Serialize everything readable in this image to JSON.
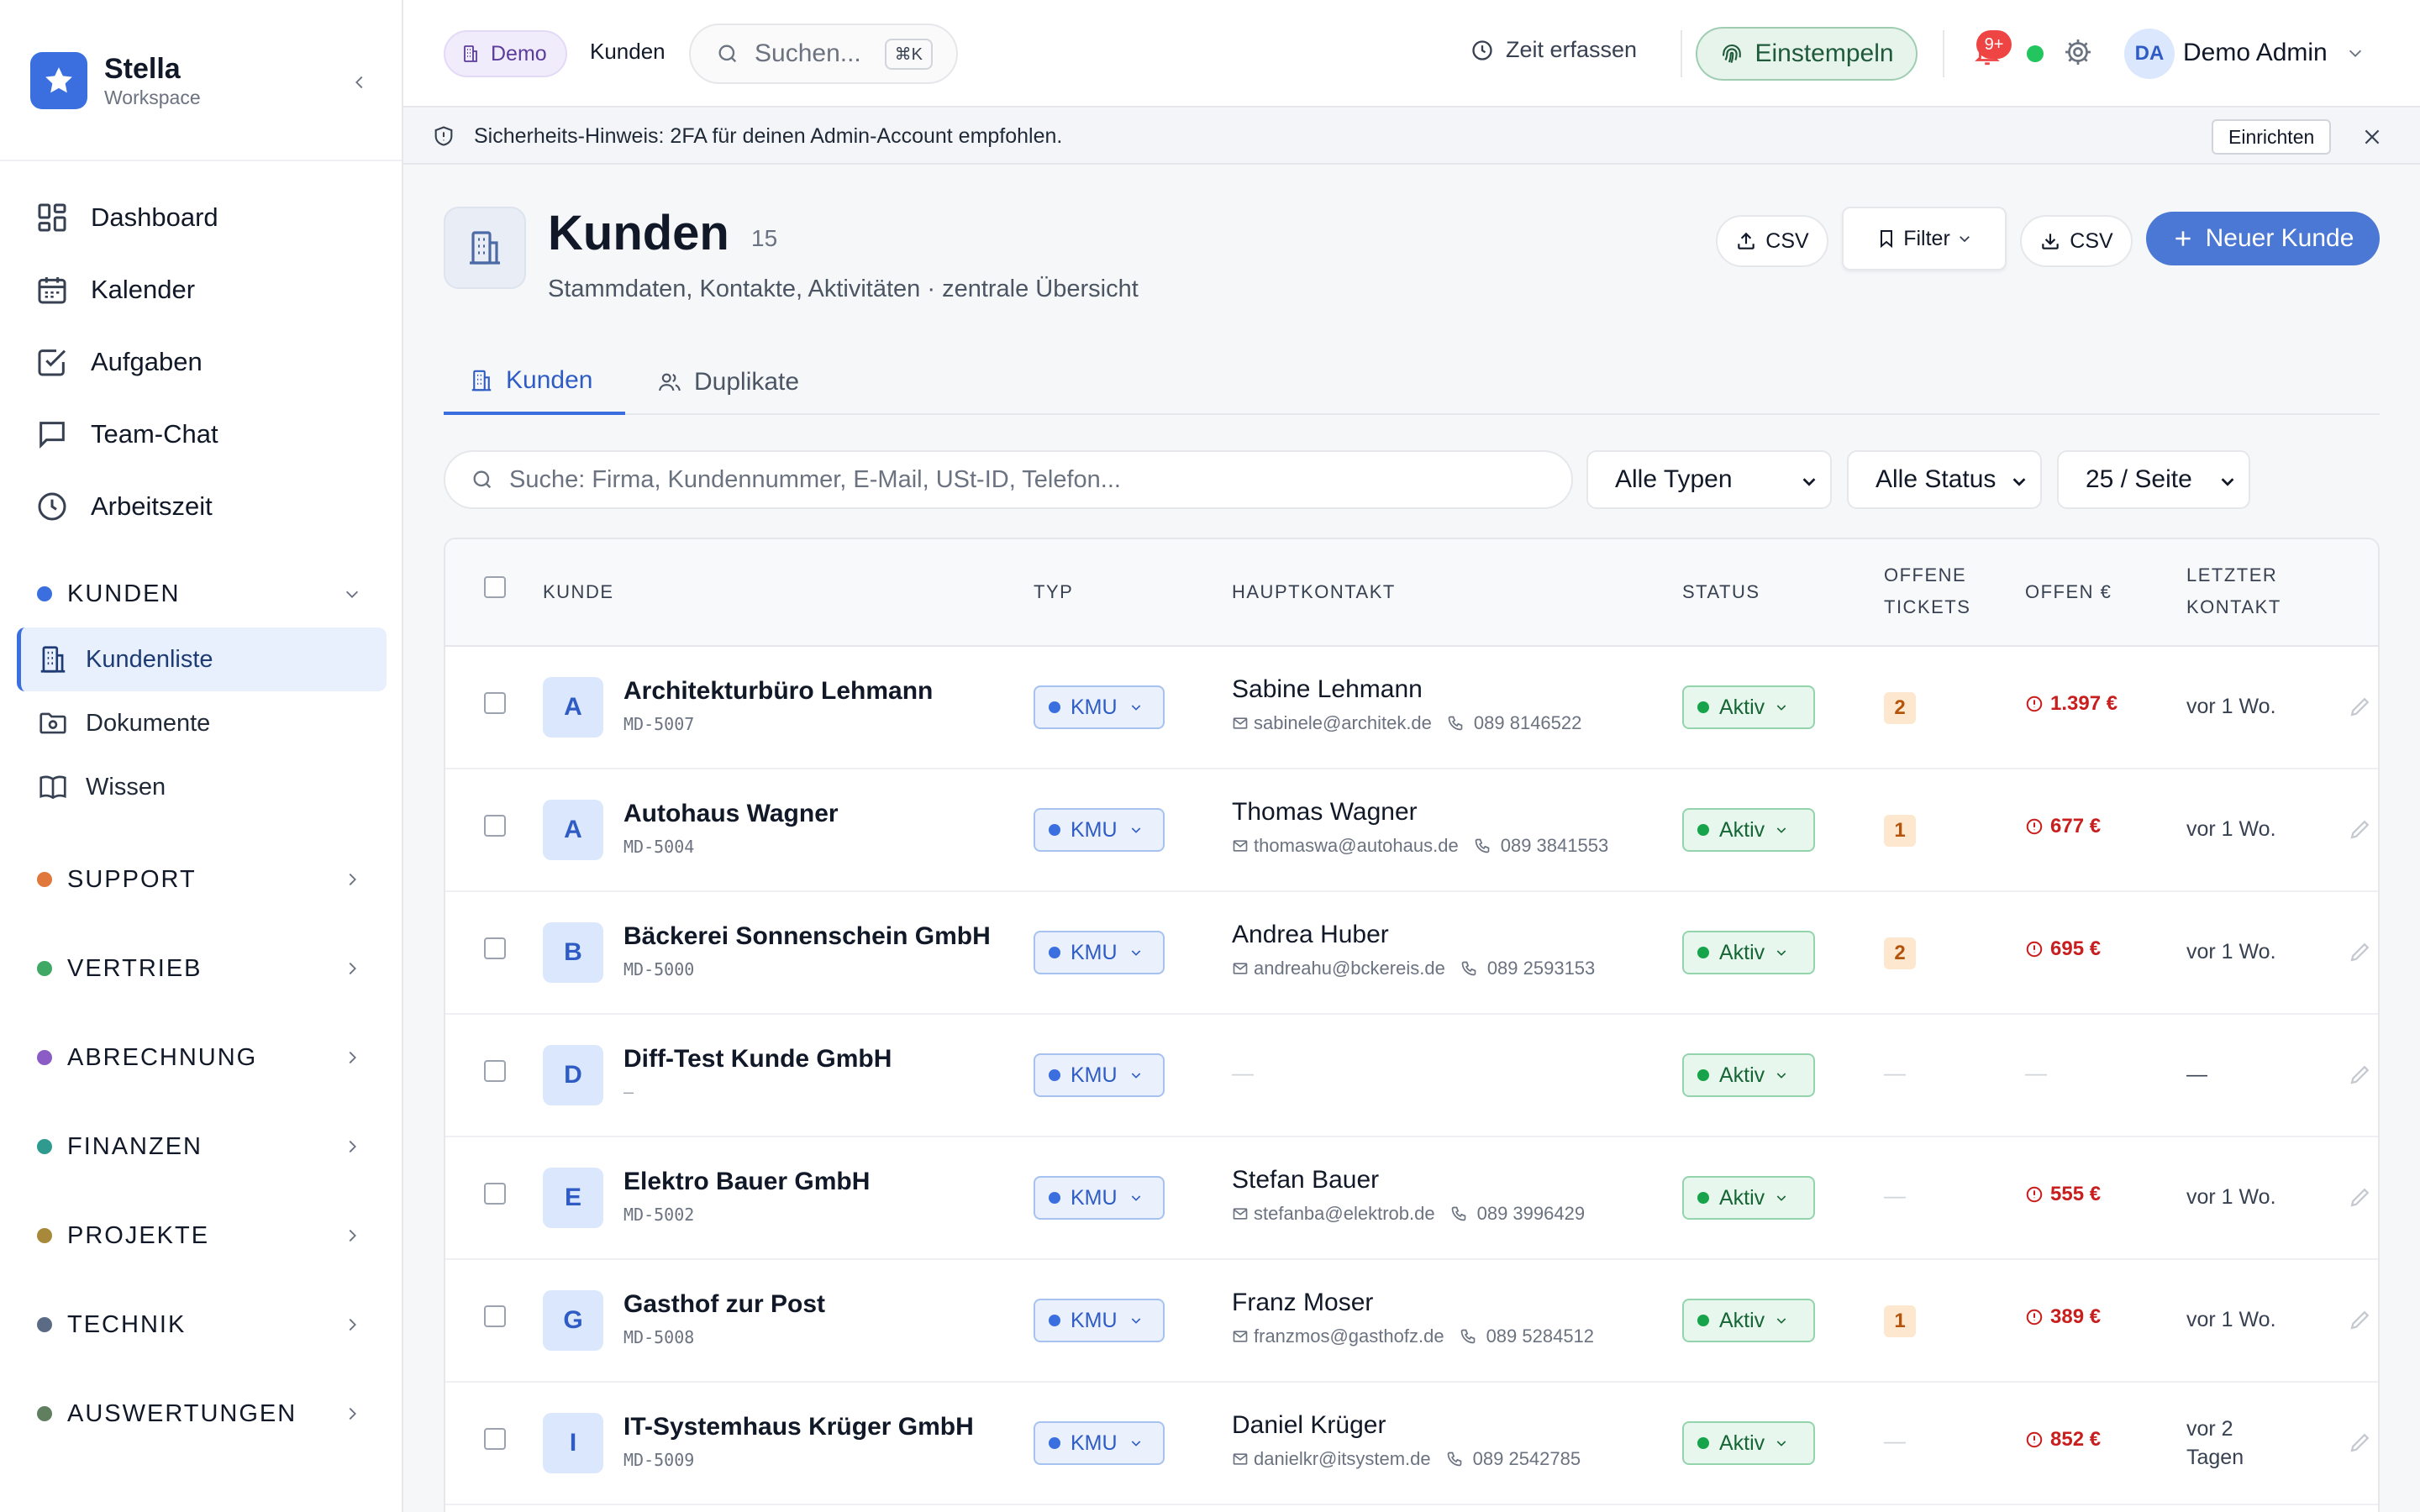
{
  "app": {
    "name": "Stella",
    "workspace": "Workspace"
  },
  "sidebar": {
    "main": [
      {
        "label": "Dashboard",
        "icon": "dashboard-icon"
      },
      {
        "label": "Kalender",
        "icon": "calendar-icon"
      },
      {
        "label": "Aufgaben",
        "icon": "tasks-icon"
      },
      {
        "label": "Team-Chat",
        "icon": "chat-icon"
      },
      {
        "label": "Arbeitszeit",
        "icon": "clock-icon"
      }
    ],
    "groups": [
      {
        "label": "KUNDEN",
        "color": "#3b6fe0",
        "expanded": true,
        "items": [
          {
            "label": "Kundenliste",
            "active": true
          },
          {
            "label": "Dokumente"
          },
          {
            "label": "Wissen"
          }
        ]
      },
      {
        "label": "SUPPORT",
        "color": "#e0773b"
      },
      {
        "label": "VERTRIEB",
        "color": "#3fa864"
      },
      {
        "label": "ABRECHNUNG",
        "color": "#8b5cc6"
      },
      {
        "label": "FINANZEN",
        "color": "#2f9a8e"
      },
      {
        "label": "PROJEKTE",
        "color": "#a8893a"
      },
      {
        "label": "TECHNIK",
        "color": "#5b6b85"
      },
      {
        "label": "AUSWERTUNGEN",
        "color": "#5f7f5f"
      }
    ]
  },
  "topbar": {
    "demo_label": "Demo",
    "breadcrumb": "Kunden",
    "search_placeholder": "Suchen...",
    "shortcut": "⌘K",
    "zeit_label": "Zeit erfassen",
    "einstempeln_label": "Einstempeln",
    "notifications": "9+",
    "user_initials": "DA",
    "user_name": "Demo Admin"
  },
  "banner": {
    "text": "Sicherheits-Hinweis: 2FA für deinen Admin-Account empfohlen.",
    "action": "Einrichten"
  },
  "page": {
    "title": "Kunden",
    "count": "15",
    "subtitle": "Stammdaten, Kontakte, Aktivitäten · zentrale Übersicht",
    "import_label": "CSV",
    "filter_label": "Filter",
    "export_label": "CSV",
    "new_label": "Neuer Kunde"
  },
  "tabs": [
    {
      "label": "Kunden",
      "active": true
    },
    {
      "label": "Duplikate",
      "active": false
    }
  ],
  "filters": {
    "search_placeholder": "Suche: Firma, Kundennummer, E-Mail, USt-ID, Telefon...",
    "type_select": "Alle Typen",
    "status_select": "Alle Status",
    "per_page_select": "25 / Seite"
  },
  "table": {
    "headers": {
      "kunde": "KUNDE",
      "typ": "TYP",
      "hauptkontakt": "HAUPTKONTAKT",
      "status": "STATUS",
      "tickets_1": "OFFENE",
      "tickets_2": "TICKETS",
      "offen": "OFFEN €",
      "letzter_1": "LETZTER",
      "letzter_2": "KONTAKT"
    },
    "rows": [
      {
        "letter": "A",
        "name": "Architekturbüro Lehmann",
        "number": "MD-5007",
        "type": "KMU",
        "contact": "Sabine Lehmann",
        "email": "sabinele@architek.de",
        "phone": "089 8146522",
        "status": "Aktiv",
        "tickets": "2",
        "open": "1.397 €",
        "last": "vor 1 Wo."
      },
      {
        "letter": "A",
        "name": "Autohaus Wagner",
        "number": "MD-5004",
        "type": "KMU",
        "contact": "Thomas Wagner",
        "email": "thomaswa@autohaus.de",
        "phone": "089 3841553",
        "status": "Aktiv",
        "tickets": "1",
        "open": "677 €",
        "last": "vor 1 Wo."
      },
      {
        "letter": "B",
        "name": "Bäckerei Sonnenschein GmbH",
        "number": "MD-5000",
        "type": "KMU",
        "contact": "Andrea Huber",
        "email": "andreahu@bckereis.de",
        "phone": "089 2593153",
        "status": "Aktiv",
        "tickets": "2",
        "open": "695 €",
        "last": "vor 1 Wo."
      },
      {
        "letter": "D",
        "name": "Diff-Test Kunde GmbH",
        "number": "—",
        "type": "KMU",
        "contact": "—",
        "email": "",
        "phone": "",
        "status": "Aktiv",
        "tickets": "—",
        "open": "—",
        "last": "—"
      },
      {
        "letter": "E",
        "name": "Elektro Bauer GmbH",
        "number": "MD-5002",
        "type": "KMU",
        "contact": "Stefan Bauer",
        "email": "stefanba@elektrob.de",
        "phone": "089 3996429",
        "status": "Aktiv",
        "tickets": "—",
        "open": "555 €",
        "last": "vor 1 Wo."
      },
      {
        "letter": "G",
        "name": "Gasthof zur Post",
        "number": "MD-5008",
        "type": "KMU",
        "contact": "Franz Moser",
        "email": "franzmos@gasthofz.de",
        "phone": "089 5284512",
        "status": "Aktiv",
        "tickets": "1",
        "open": "389 €",
        "last": "vor 1 Wo."
      },
      {
        "letter": "I",
        "name": "IT-Systemhaus Krüger GmbH",
        "number": "MD-5009",
        "type": "KMU",
        "contact": "Daniel Krüger",
        "email": "danielkr@itsystem.de",
        "phone": "089 2542785",
        "status": "Aktiv",
        "tickets": "—",
        "open": "852 €",
        "last_1": "vor 2",
        "last_2": "Tagen"
      }
    ]
  }
}
